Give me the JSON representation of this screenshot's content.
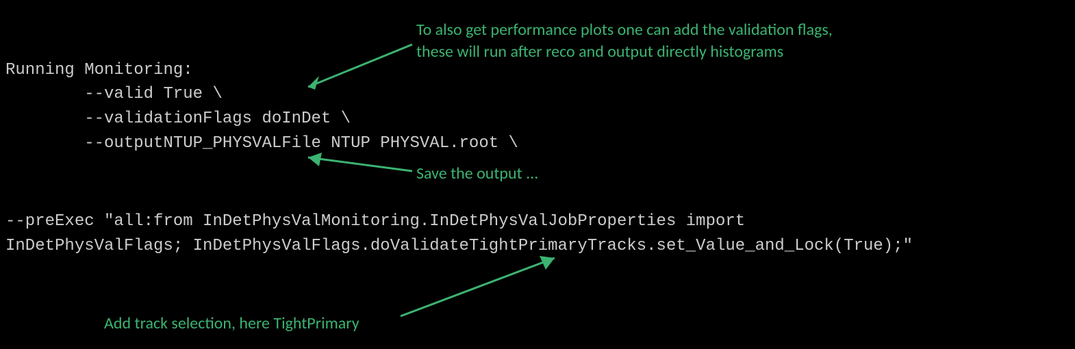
{
  "code": {
    "heading": "Running Monitoring:",
    "line1": "        --valid True \\",
    "line2": "        --validationFlags doInDet \\",
    "line3": "        --outputNTUP_PHYSVALFile NTUP PHYSVAL.root \\",
    "preexec1": "--preExec \"all:from InDetPhysValMonitoring.InDetPhysValJobProperties import",
    "preexec2": "InDetPhysValFlags; InDetPhysValFlags.doValidateTightPrimaryTracks.set_Value_and_Lock(True);\""
  },
  "annotations": {
    "top1": "To also get performance plots one can add the validation flags,",
    "top2": "these will run after reco and output directly histograms",
    "middle": "Save the output ...",
    "bottom": "Add track selection, here TightPrimary"
  }
}
